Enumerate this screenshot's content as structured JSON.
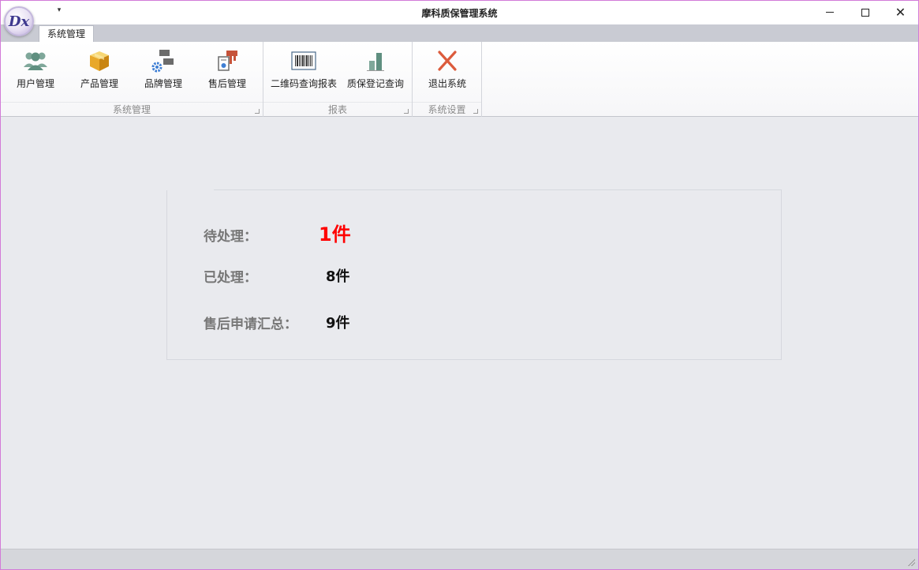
{
  "window": {
    "title": "摩科质保管理系统",
    "logo_text": "Dx",
    "qat_dropdown": "▾",
    "controls": {
      "minimize": "minimize",
      "maximize": "maximize",
      "close": "✕"
    }
  },
  "ribbon": {
    "tabs": [
      {
        "label": "系统管理",
        "active": true
      }
    ],
    "groups": [
      {
        "label": "系统管理",
        "buttons": [
          {
            "label": "用户管理",
            "icon": "users-icon"
          },
          {
            "label": "产品管理",
            "icon": "box-icon"
          },
          {
            "label": "品牌管理",
            "icon": "brand-settings-icon"
          },
          {
            "label": "售后管理",
            "icon": "after-sales-icon"
          }
        ]
      },
      {
        "label": "报表",
        "buttons": [
          {
            "label": "二维码查询报表",
            "icon": "barcode-icon"
          },
          {
            "label": "质保登记查询",
            "icon": "bar-chart-icon"
          }
        ]
      },
      {
        "label": "系统设置",
        "buttons": [
          {
            "label": "退出系统",
            "icon": "exit-x-icon"
          }
        ]
      }
    ]
  },
  "summary": {
    "pending": {
      "label": "待处理：",
      "value": "1件"
    },
    "processed": {
      "label": "已处理：",
      "value": "8件"
    },
    "total": {
      "label": "售后申请汇总：",
      "value": "9件"
    }
  },
  "colors": {
    "alert": "#ff0000",
    "accent_window_border": "#d27bd8",
    "background": "#e9eaee"
  }
}
